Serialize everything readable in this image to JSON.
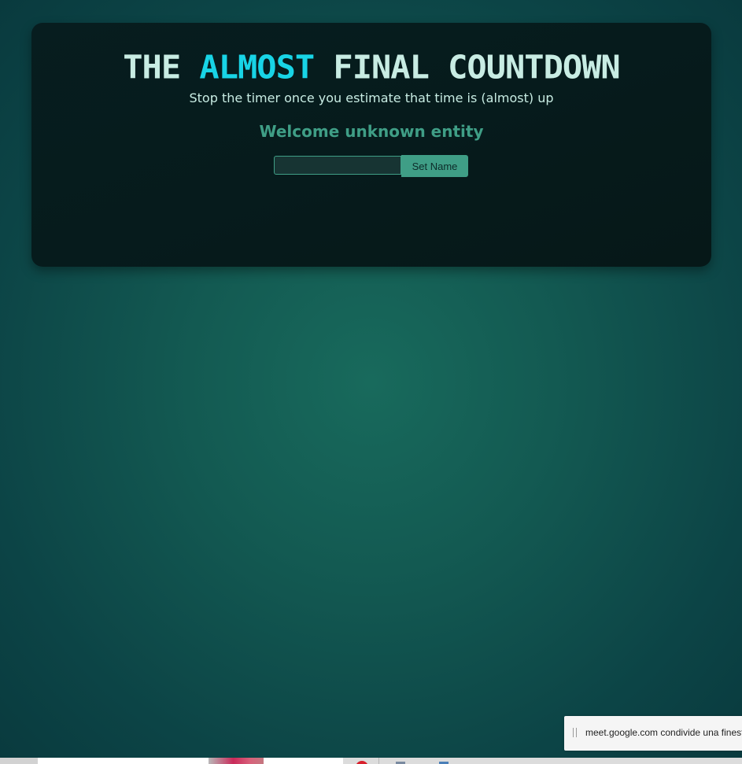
{
  "app": {
    "title_parts": [
      "THE ",
      "ALMOST",
      " FINAL COUNTDOWN"
    ],
    "subtitle": "Stop the timer once you estimate that time is (almost) up",
    "welcome": "Welcome unknown entity"
  },
  "name_form": {
    "input_value": "",
    "button_label": "Set Name"
  },
  "share_notification": {
    "text": "meet.google.com condivide una finestra."
  },
  "colors": {
    "title": "#c8ece3",
    "accent": "#18d4e6",
    "welcome": "#3f9e86",
    "button": "#3f9e86",
    "card": "#061b1c"
  }
}
